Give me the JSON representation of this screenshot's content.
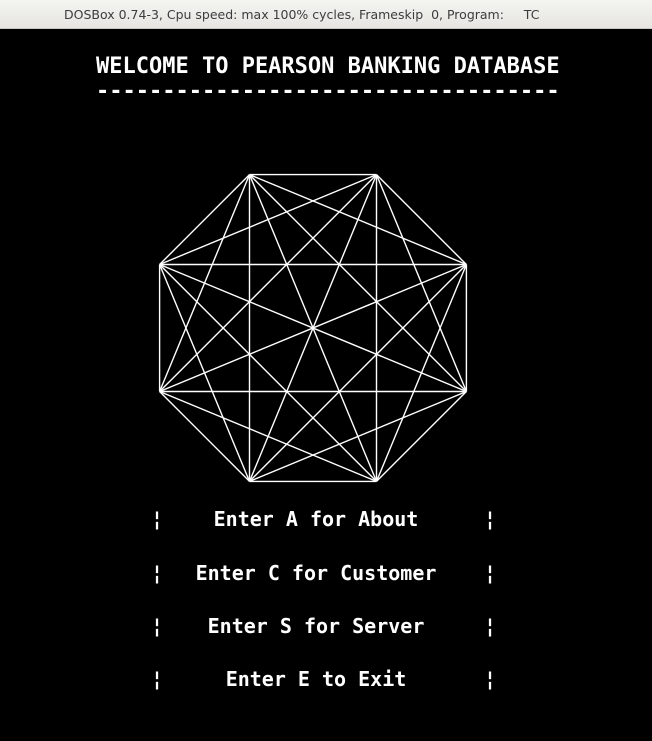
{
  "window": {
    "title": "DOSBox 0.74-3, Cpu speed: max 100% cycles, Frameskip  0, Program:     TC"
  },
  "screen": {
    "heading": "WELCOME TO PEARSON BANKING DATABASE",
    "heading_rule": "-----------------------------------",
    "menu": [
      {
        "label": "Enter A for About",
        "left_bar": "¦",
        "right_bar": "¦"
      },
      {
        "label": "Enter C for Customer",
        "left_bar": "¦",
        "right_bar": "¦"
      },
      {
        "label": "Enter S for Server",
        "left_bar": "¦",
        "right_bar": "¦"
      },
      {
        "label": "Enter E to Exit",
        "left_bar": "¦",
        "right_bar": "¦"
      }
    ]
  },
  "colors": {
    "foreground": "#ffffff",
    "background": "#000000",
    "titlebar": "#eceae6"
  }
}
